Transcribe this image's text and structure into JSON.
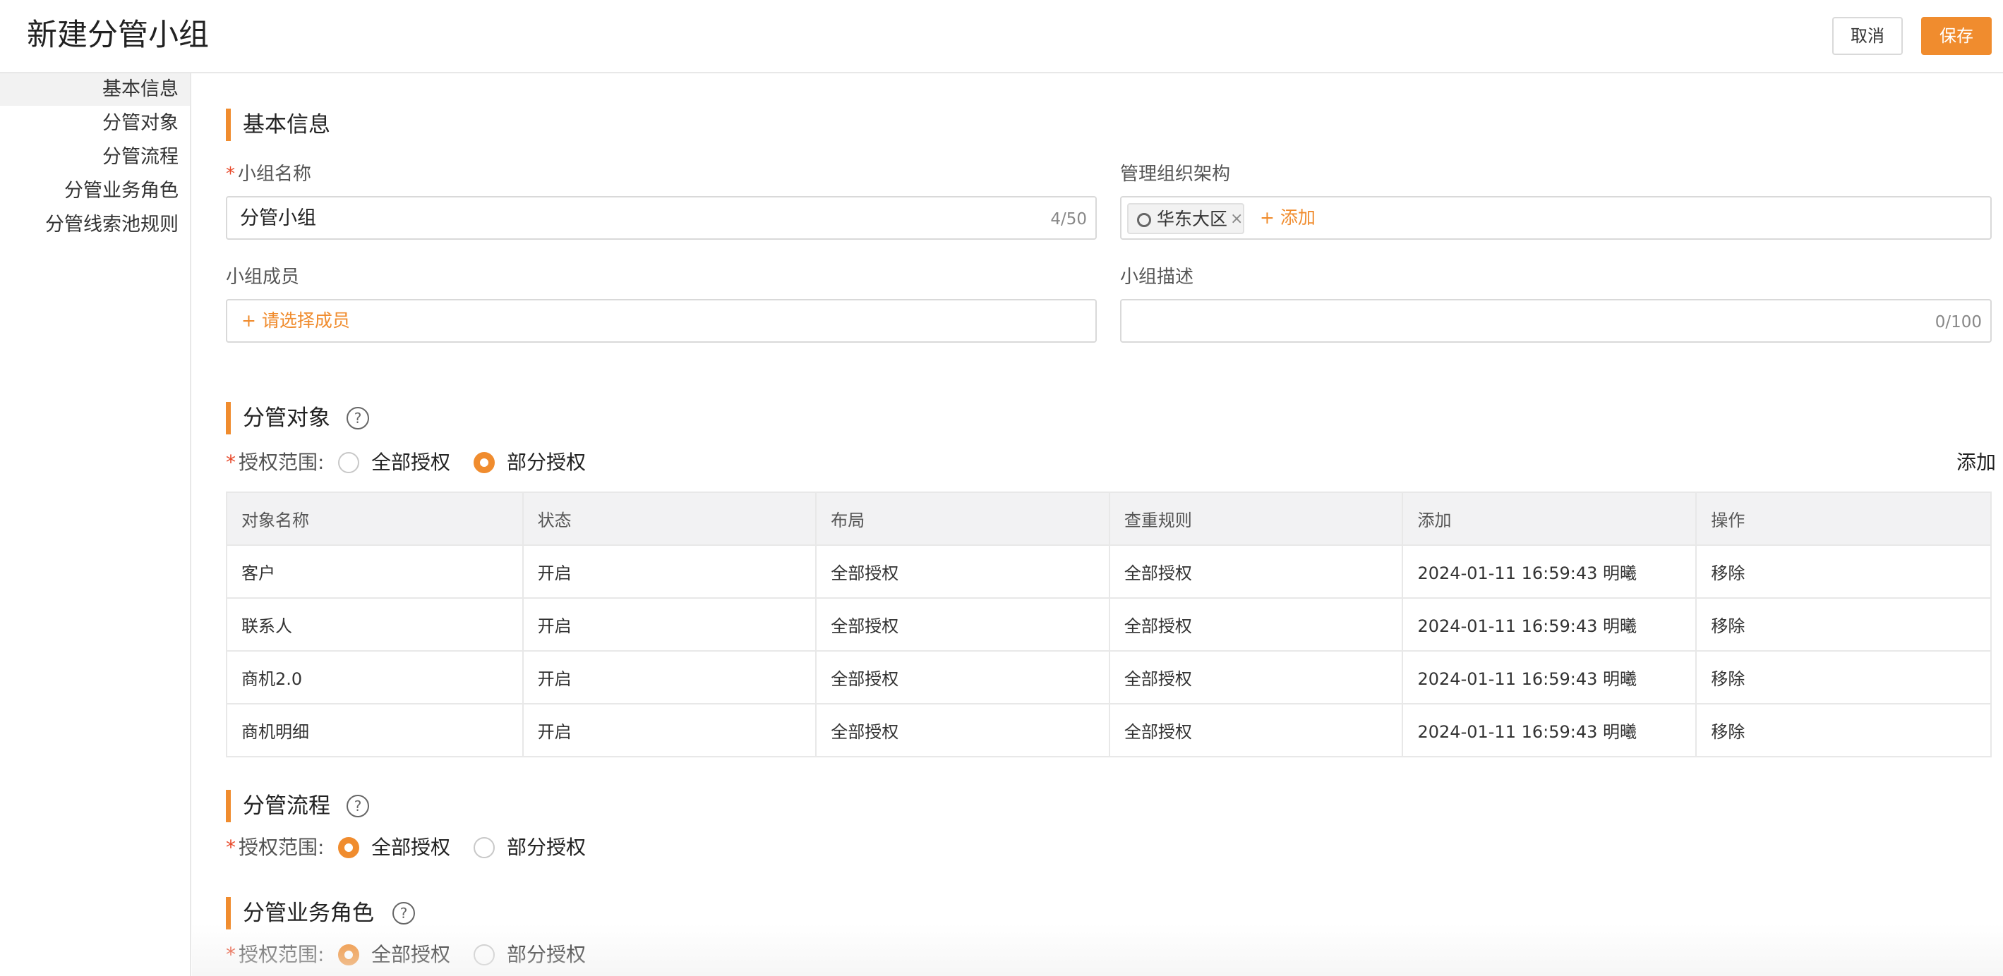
{
  "header": {
    "title": "新建分管小组",
    "cancel_label": "取消",
    "save_label": "保存"
  },
  "sidebar": {
    "items": [
      {
        "label": "基本信息",
        "active": true
      },
      {
        "label": "分管对象",
        "active": false
      },
      {
        "label": "分管流程",
        "active": false
      },
      {
        "label": "分管业务角色",
        "active": false
      },
      {
        "label": "分管线索池规则",
        "active": false
      }
    ]
  },
  "basic_info": {
    "title": "基本信息",
    "group_name": {
      "required_mark": "*",
      "label": "小组名称",
      "value": "分管小组",
      "counter": "4/50"
    },
    "org": {
      "label": "管理组织架构",
      "tag": "华东大区",
      "tag_close": "×",
      "add_label": "+ 添加"
    },
    "members": {
      "label": "小组成员",
      "placeholder": "+ 请选择成员"
    },
    "description": {
      "label": "小组描述",
      "value": "",
      "counter": "0/100"
    }
  },
  "objects": {
    "title": "分管对象",
    "help": "?",
    "scope_label": "授权范围:",
    "required_mark": "*",
    "option_all": "全部授权",
    "option_partial": "部分授权",
    "selected": "partial",
    "add_label": "添加",
    "columns": [
      "对象名称",
      "状态",
      "布局",
      "查重规则",
      "添加",
      "操作"
    ],
    "rows": [
      {
        "name": "客户",
        "status": "开启",
        "layout": "全部授权",
        "dedupe": "全部授权",
        "added": "2024-01-11 16:59:43 明曦",
        "action": "移除"
      },
      {
        "name": "联系人",
        "status": "开启",
        "layout": "全部授权",
        "dedupe": "全部授权",
        "added": "2024-01-11 16:59:43 明曦",
        "action": "移除"
      },
      {
        "name": "商机2.0",
        "status": "开启",
        "layout": "全部授权",
        "dedupe": "全部授权",
        "added": "2024-01-11 16:59:43 明曦",
        "action": "移除"
      },
      {
        "name": "商机明细",
        "status": "开启",
        "layout": "全部授权",
        "dedupe": "全部授权",
        "added": "2024-01-11 16:59:43 明曦",
        "action": "移除"
      }
    ]
  },
  "process": {
    "title": "分管流程",
    "help": "?",
    "required_mark": "*",
    "scope_label": "授权范围:",
    "option_all": "全部授权",
    "option_partial": "部分授权",
    "selected": "all"
  },
  "roles": {
    "title": "分管业务角色",
    "help": "?",
    "required_mark": "*",
    "scope_label": "授权范围:",
    "option_all": "全部授权",
    "option_partial": "部分授权",
    "selected": "all"
  },
  "colors": {
    "accent": "#f08c2e",
    "required": "#e8492a",
    "border": "#d9d9d9",
    "table_header_bg": "#f2f2f3"
  }
}
